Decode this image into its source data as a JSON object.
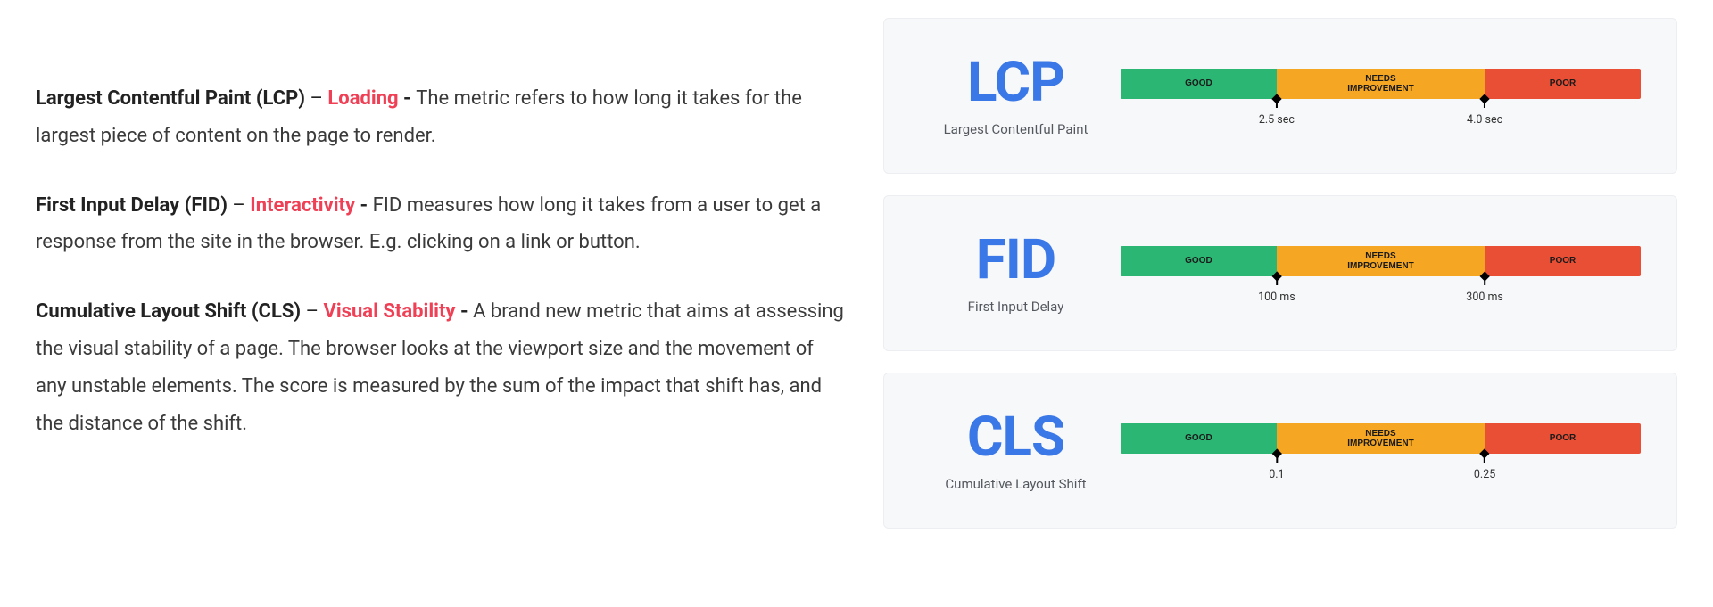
{
  "definitions": [
    {
      "bold": "Largest Contentful Paint (LCP)",
      "sep": " – ",
      "category": "Loading",
      "dash": " - ",
      "text": "The metric refers to how long it takes for the largest piece of content on the page to render."
    },
    {
      "bold": "First Input Delay (FID)",
      "sep": " – ",
      "category": "Interactivity",
      "dash": " - ",
      "text": "FID measures how long it takes from a user to get a response from the site in the browser. E.g. clicking on a link or button."
    },
    {
      "bold": "Cumulative Layout Shift (CLS)",
      "sep": " – ",
      "category": "Visual Stability",
      "dash": " - ",
      "text": "A brand new metric that aims at assessing the visual stability of a page. The browser looks at the viewport size and the movement of any unstable elements. The score is measured by the sum of the impact that shift has, and the distance of the shift."
    }
  ],
  "segments": {
    "good": "GOOD",
    "needs": "NEEDS\nIMPROVEMENT",
    "poor": "POOR"
  },
  "cards": [
    {
      "abbr": "LCP",
      "full": "Largest Contentful Paint",
      "t1": "2.5 sec",
      "t2": "4.0 sec"
    },
    {
      "abbr": "FID",
      "full": "First Input Delay",
      "t1": "100 ms",
      "t2": "300 ms"
    },
    {
      "abbr": "CLS",
      "full": "Cumulative Layout Shift",
      "t1": "0.1",
      "t2": "0.25"
    }
  ],
  "chart_data": [
    {
      "type": "bar",
      "title": "LCP — Largest Contentful Paint",
      "categories": [
        "GOOD",
        "NEEDS IMPROVEMENT",
        "POOR"
      ],
      "thresholds": {
        "good_max": "2.5 sec",
        "poor_min": "4.0 sec"
      },
      "colors": {
        "good": "#2bb673",
        "needs": "#f5a623",
        "poor": "#e94f35"
      }
    },
    {
      "type": "bar",
      "title": "FID — First Input Delay",
      "categories": [
        "GOOD",
        "NEEDS IMPROVEMENT",
        "POOR"
      ],
      "thresholds": {
        "good_max": "100 ms",
        "poor_min": "300 ms"
      },
      "colors": {
        "good": "#2bb673",
        "needs": "#f5a623",
        "poor": "#e94f35"
      }
    },
    {
      "type": "bar",
      "title": "CLS — Cumulative Layout Shift",
      "categories": [
        "GOOD",
        "NEEDS IMPROVEMENT",
        "POOR"
      ],
      "thresholds": {
        "good_max": "0.1",
        "poor_min": "0.25"
      },
      "colors": {
        "good": "#2bb673",
        "needs": "#f5a623",
        "poor": "#e94f35"
      }
    }
  ]
}
